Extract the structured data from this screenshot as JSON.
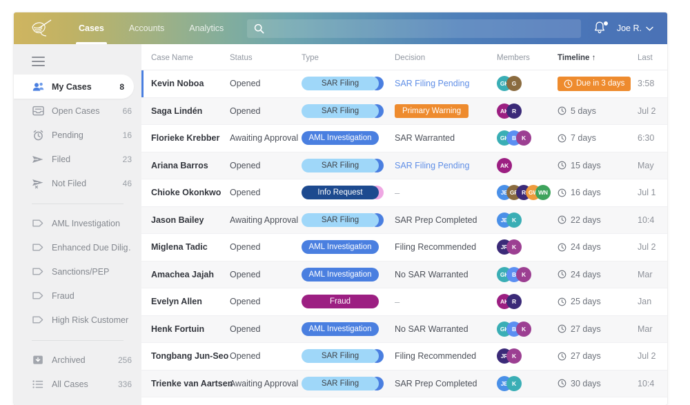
{
  "topnav": {
    "logo_icon": "bird-logo-icon",
    "items": [
      {
        "label": "Cases",
        "active": true
      },
      {
        "label": "Accounts",
        "active": false
      },
      {
        "label": "Analytics",
        "active": false
      }
    ],
    "search": {
      "icon": "search-icon",
      "value": "",
      "placeholder": ""
    },
    "notifications_icon": "bell-icon",
    "user": {
      "label": "Joe R.",
      "chevron_icon": "chevron-down-icon"
    }
  },
  "sidebar": {
    "menu_icon": "hamburger-menu-icon",
    "items": [
      {
        "label": "My Cases",
        "count": "8",
        "icon": "people-icon",
        "active": true
      },
      {
        "label": "Open Cases",
        "count": "66",
        "icon": "inbox-icon",
        "active": false
      },
      {
        "label": "Pending",
        "count": "16",
        "icon": "alarm-clock-icon",
        "active": false
      },
      {
        "label": "Filed",
        "count": "23",
        "icon": "send-icon",
        "active": false
      },
      {
        "label": "Not Filed",
        "count": "46",
        "icon": "send-x-icon",
        "active": false
      }
    ],
    "tags": [
      {
        "label": "AML Investigation",
        "icon": "tag-icon"
      },
      {
        "label": "Enhanced Due Dilig…",
        "icon": "tag-icon"
      },
      {
        "label": "Sanctions/PEP",
        "icon": "tag-icon"
      },
      {
        "label": "Fraud",
        "icon": "tag-icon"
      },
      {
        "label": "High Risk Customer",
        "icon": "tag-icon"
      }
    ],
    "footer": [
      {
        "label": "Archived",
        "count": "256",
        "icon": "archive-icon"
      },
      {
        "label": "All Cases",
        "count": "336",
        "icon": "list-icon"
      }
    ]
  },
  "table": {
    "columns": [
      {
        "label": "Case Name",
        "sorted": false
      },
      {
        "label": "Status",
        "sorted": false
      },
      {
        "label": "Type",
        "sorted": false
      },
      {
        "label": "Decision",
        "sorted": false
      },
      {
        "label": "Members",
        "sorted": false
      },
      {
        "label": "Timeline ↑",
        "sorted": true
      },
      {
        "label": "Last",
        "sorted": false
      }
    ],
    "rows": [
      {
        "name": "Kevin Noboa",
        "status": "Opened",
        "type": {
          "label": "SAR Filing",
          "style": "sar"
        },
        "decision": {
          "text": "SAR Filing Pending",
          "style": "link"
        },
        "members": [
          {
            "initials": "GK",
            "color": "#3aaeb5"
          },
          {
            "initials": "G",
            "color": "#8a6b3f"
          }
        ],
        "timeline": {
          "text": "Due in 3 days",
          "style": "badge"
        },
        "last": "3:58",
        "selected": true,
        "stripe": false
      },
      {
        "name": "Saga Lindén",
        "status": "Opened",
        "type": {
          "label": "SAR Filing",
          "style": "sar"
        },
        "decision": {
          "text": "Primary Warning",
          "style": "warn"
        },
        "members": [
          {
            "initials": "AK",
            "color": "#9c1f82"
          },
          {
            "initials": "R",
            "color": "#3b2a78"
          }
        ],
        "timeline": {
          "text": "5 days",
          "style": "plain"
        },
        "last": "Jul 2",
        "selected": false,
        "stripe": true
      },
      {
        "name": "Florieke Krebber",
        "status": "Awaiting Approval",
        "type": {
          "label": "AML Investigation",
          "style": "aml"
        },
        "decision": {
          "text": "SAR Warranted",
          "style": "text"
        },
        "members": [
          {
            "initials": "GK",
            "color": "#3aaeb5"
          },
          {
            "initials": "B",
            "color": "#5b8ff2"
          },
          {
            "initials": "K",
            "color": "#9c3f92"
          }
        ],
        "timeline": {
          "text": "7 days",
          "style": "plain"
        },
        "last": "6:30",
        "selected": false,
        "stripe": false
      },
      {
        "name": "Ariana Barros",
        "status": "Opened",
        "type": {
          "label": "SAR Filing",
          "style": "sar"
        },
        "decision": {
          "text": "SAR Filing Pending",
          "style": "link"
        },
        "members": [
          {
            "initials": "AK",
            "color": "#9c1f82"
          }
        ],
        "timeline": {
          "text": "15 days",
          "style": "plain"
        },
        "last": "May",
        "selected": false,
        "stripe": true
      },
      {
        "name": "Chioke Okonkwo",
        "status": "Opened",
        "type": {
          "label": "Info Request",
          "style": "info"
        },
        "decision": {
          "text": "–",
          "style": "dash"
        },
        "members": [
          {
            "initials": "JB",
            "color": "#4a90e8"
          },
          {
            "initials": "GR",
            "color": "#8a6b3f"
          },
          {
            "initials": "R",
            "color": "#3b2a78"
          },
          {
            "initials": "GW",
            "color": "#ee9b3d"
          },
          {
            "initials": "WN",
            "color": "#3ea35c"
          }
        ],
        "timeline": {
          "text": "16 days",
          "style": "plain"
        },
        "last": "Jul 1",
        "selected": false,
        "stripe": false
      },
      {
        "name": "Jason Bailey",
        "status": "Awaiting Approval",
        "type": {
          "label": "SAR Filing",
          "style": "sar"
        },
        "decision": {
          "text": "SAR Prep Completed",
          "style": "text"
        },
        "members": [
          {
            "initials": "JB",
            "color": "#4a90e8"
          },
          {
            "initials": "K",
            "color": "#3aaeb5"
          }
        ],
        "timeline": {
          "text": "22 days",
          "style": "plain"
        },
        "last": "10:4",
        "selected": false,
        "stripe": true
      },
      {
        "name": "Miglena Tadic",
        "status": "Opened",
        "type": {
          "label": "AML Investigation",
          "style": "aml"
        },
        "decision": {
          "text": "Filing Recommended",
          "style": "text"
        },
        "members": [
          {
            "initials": "JR",
            "color": "#3b2a78"
          },
          {
            "initials": "K",
            "color": "#9c3f92"
          }
        ],
        "timeline": {
          "text": "24 days",
          "style": "plain"
        },
        "last": "Jul 2",
        "selected": false,
        "stripe": false
      },
      {
        "name": "Amachea Jajah",
        "status": "Opened",
        "type": {
          "label": "AML Investigation",
          "style": "aml"
        },
        "decision": {
          "text": "No SAR Warranted",
          "style": "text"
        },
        "members": [
          {
            "initials": "GK",
            "color": "#3aaeb5"
          },
          {
            "initials": "B",
            "color": "#5b8ff2"
          },
          {
            "initials": "K",
            "color": "#9c3f92"
          }
        ],
        "timeline": {
          "text": "24 days",
          "style": "plain"
        },
        "last": "Mar",
        "selected": false,
        "stripe": true
      },
      {
        "name": "Evelyn Allen",
        "status": "Opened",
        "type": {
          "label": "Fraud",
          "style": "fraud"
        },
        "decision": {
          "text": "–",
          "style": "dash"
        },
        "members": [
          {
            "initials": "AK",
            "color": "#9c1f82"
          },
          {
            "initials": "R",
            "color": "#3b2a78"
          }
        ],
        "timeline": {
          "text": "25 days",
          "style": "plain"
        },
        "last": "Jan",
        "selected": false,
        "stripe": false
      },
      {
        "name": "Henk Fortuin",
        "status": "Opened",
        "type": {
          "label": "AML Investigation",
          "style": "aml"
        },
        "decision": {
          "text": "No SAR Warranted",
          "style": "text"
        },
        "members": [
          {
            "initials": "GK",
            "color": "#3aaeb5"
          },
          {
            "initials": "B",
            "color": "#5b8ff2"
          },
          {
            "initials": "K",
            "color": "#9c3f92"
          }
        ],
        "timeline": {
          "text": "27 days",
          "style": "plain"
        },
        "last": "Mar",
        "selected": false,
        "stripe": true
      },
      {
        "name": "Tongbang Jun-Seo",
        "status": "Opened",
        "type": {
          "label": "SAR Filing",
          "style": "sar"
        },
        "decision": {
          "text": "Filing Recommended",
          "style": "text"
        },
        "members": [
          {
            "initials": "JR",
            "color": "#3b2a78"
          },
          {
            "initials": "K",
            "color": "#9c3f92"
          }
        ],
        "timeline": {
          "text": "27 days",
          "style": "plain"
        },
        "last": "Jul 2",
        "selected": false,
        "stripe": false
      },
      {
        "name": "Trienke van Aartsen",
        "status": "Awaiting Approval",
        "type": {
          "label": "SAR Filing",
          "style": "sar"
        },
        "decision": {
          "text": "SAR Prep Completed",
          "style": "text"
        },
        "members": [
          {
            "initials": "JB",
            "color": "#4a90e8"
          },
          {
            "initials": "K",
            "color": "#3aaeb5"
          }
        ],
        "timeline": {
          "text": "30 days",
          "style": "plain"
        },
        "last": "10:4",
        "selected": false,
        "stripe": true
      }
    ]
  }
}
